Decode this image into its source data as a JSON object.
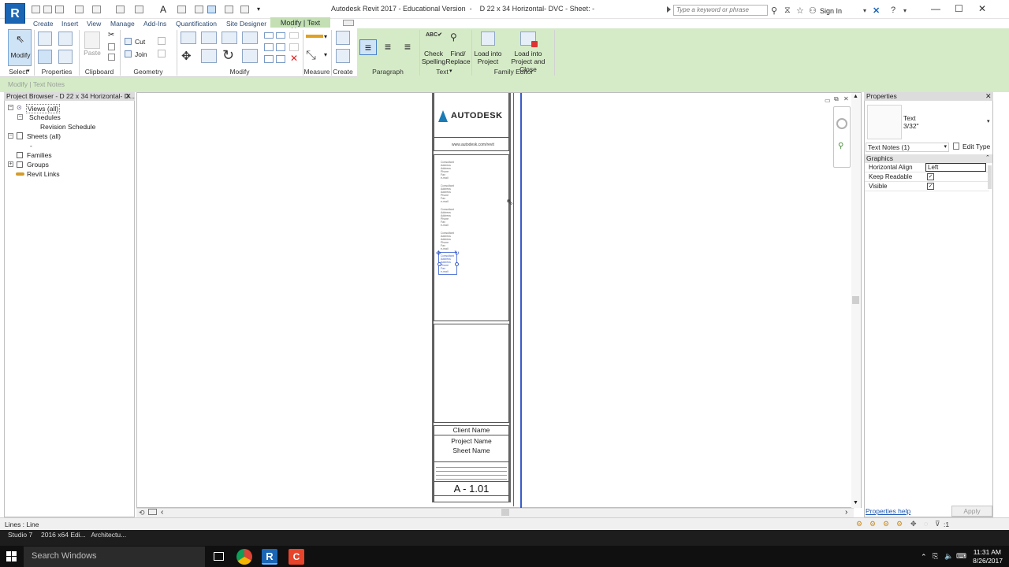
{
  "title_bar": {
    "app_logo": "R",
    "window_title": "Autodesk Revit 2017 - Educational Version  -    D 22 x 34 Horizontal- DVC - Sheet: -",
    "search_placeholder": "Type a keyword or phrase",
    "sign_in": "Sign In"
  },
  "tabs": [
    "Create",
    "Insert",
    "View",
    "Manage",
    "Add-Ins",
    "Quantification",
    "Site Designer"
  ],
  "active_tab": "Modify | Text Notes",
  "ribbon": {
    "modify": "Modify",
    "cut": "Cut",
    "join": "Join",
    "paste": "Paste",
    "check_spelling_1": "Check",
    "check_spelling_2": "Spelling",
    "find_replace_1": "Find/",
    "find_replace_2": "Replace",
    "load_project_1": "Load into",
    "load_project_2": "Project",
    "load_close_1": "Load into",
    "load_close_2": "Project and Close",
    "panels": {
      "select": "Select",
      "properties": "Properties",
      "clipboard": "Clipboard",
      "geometry": "Geometry",
      "modify": "Modify",
      "measure": "Measure",
      "create": "Create",
      "paragraph": "Paragraph",
      "text": "Text",
      "family_editor": "Family Editor"
    }
  },
  "sub_bar": "Modify | Text Notes",
  "project_browser": {
    "header": "Project Browser - D 22 x 34 Horizontal- D...",
    "items": {
      "views": "Views (all)",
      "schedules": "Schedules",
      "revision_schedule": "Revision Schedule",
      "sheets": "Sheets (all)",
      "sheet_dash": "-",
      "families": "Families",
      "groups": "Groups",
      "revit_links": "Revit Links"
    }
  },
  "title_block": {
    "brand": "AUTODESK",
    "url": "www.autodesk.com/revit",
    "client": "Client Name",
    "project": "Project Name",
    "sheet": "Sheet Name",
    "sheet_number": "A - 1.01",
    "consultant_lines": [
      "Consultant",
      "Address",
      "Address",
      "Phone",
      "Fax",
      "e-mail"
    ]
  },
  "properties": {
    "header": "Properties",
    "type_name": "Text",
    "type_size": "3/32\"",
    "selector": "Text Notes (1)",
    "edit_type": "Edit Type",
    "group": "Graphics",
    "rows": [
      {
        "label": "Horizontal Align",
        "value": "Left"
      },
      {
        "label": "Keep Readable",
        "value": ""
      },
      {
        "label": "Visible",
        "value": ""
      }
    ],
    "help": "Properties help",
    "apply": "Apply"
  },
  "status_bar": {
    "text": "Lines : Line",
    "tray_suffix": ":1"
  },
  "minimized": [
    "Studio 7",
    "2016 x64 Edi...   Architectu..."
  ],
  "taskbar": {
    "search": "Search Windows",
    "time": "11:31 AM",
    "date": "8/26/2017"
  },
  "colors": {
    "ribbon_context": "#d5ebc7",
    "accent_blue": "#1b65b5",
    "selection_blue": "#3a5cc8"
  }
}
